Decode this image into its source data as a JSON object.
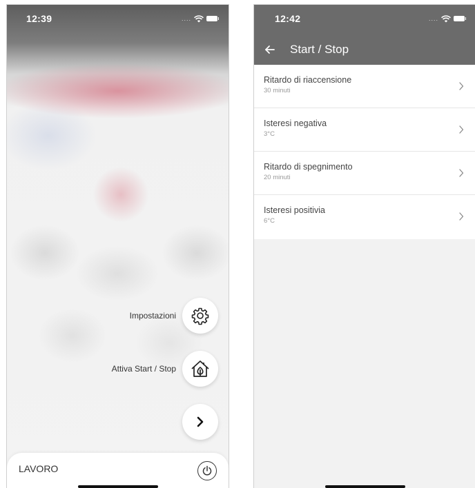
{
  "left_screen": {
    "status_time": "12:39",
    "status_dots": "....",
    "actions": [
      {
        "label": "Impostazioni",
        "icon": "gear-icon"
      },
      {
        "label": "Attiva Start / Stop",
        "icon": "house-leaf-icon"
      },
      {
        "label": "",
        "icon": "chevron-right-icon"
      }
    ],
    "bottom_label": "LAVORO",
    "bottom_icon": "power-icon"
  },
  "right_screen": {
    "status_time": "12:42",
    "status_dots": "....",
    "title": "Start / Stop",
    "rows": [
      {
        "title": "Ritardo di riaccensione",
        "value": "30 minuti"
      },
      {
        "title": "Isteresi negativa",
        "value": "3°C"
      },
      {
        "title": "Ritardo di spegnimento",
        "value": "20 minuti"
      },
      {
        "title": "Isteresi positivia",
        "value": "6°C"
      }
    ],
    "header_color": "#6b6b6b"
  }
}
